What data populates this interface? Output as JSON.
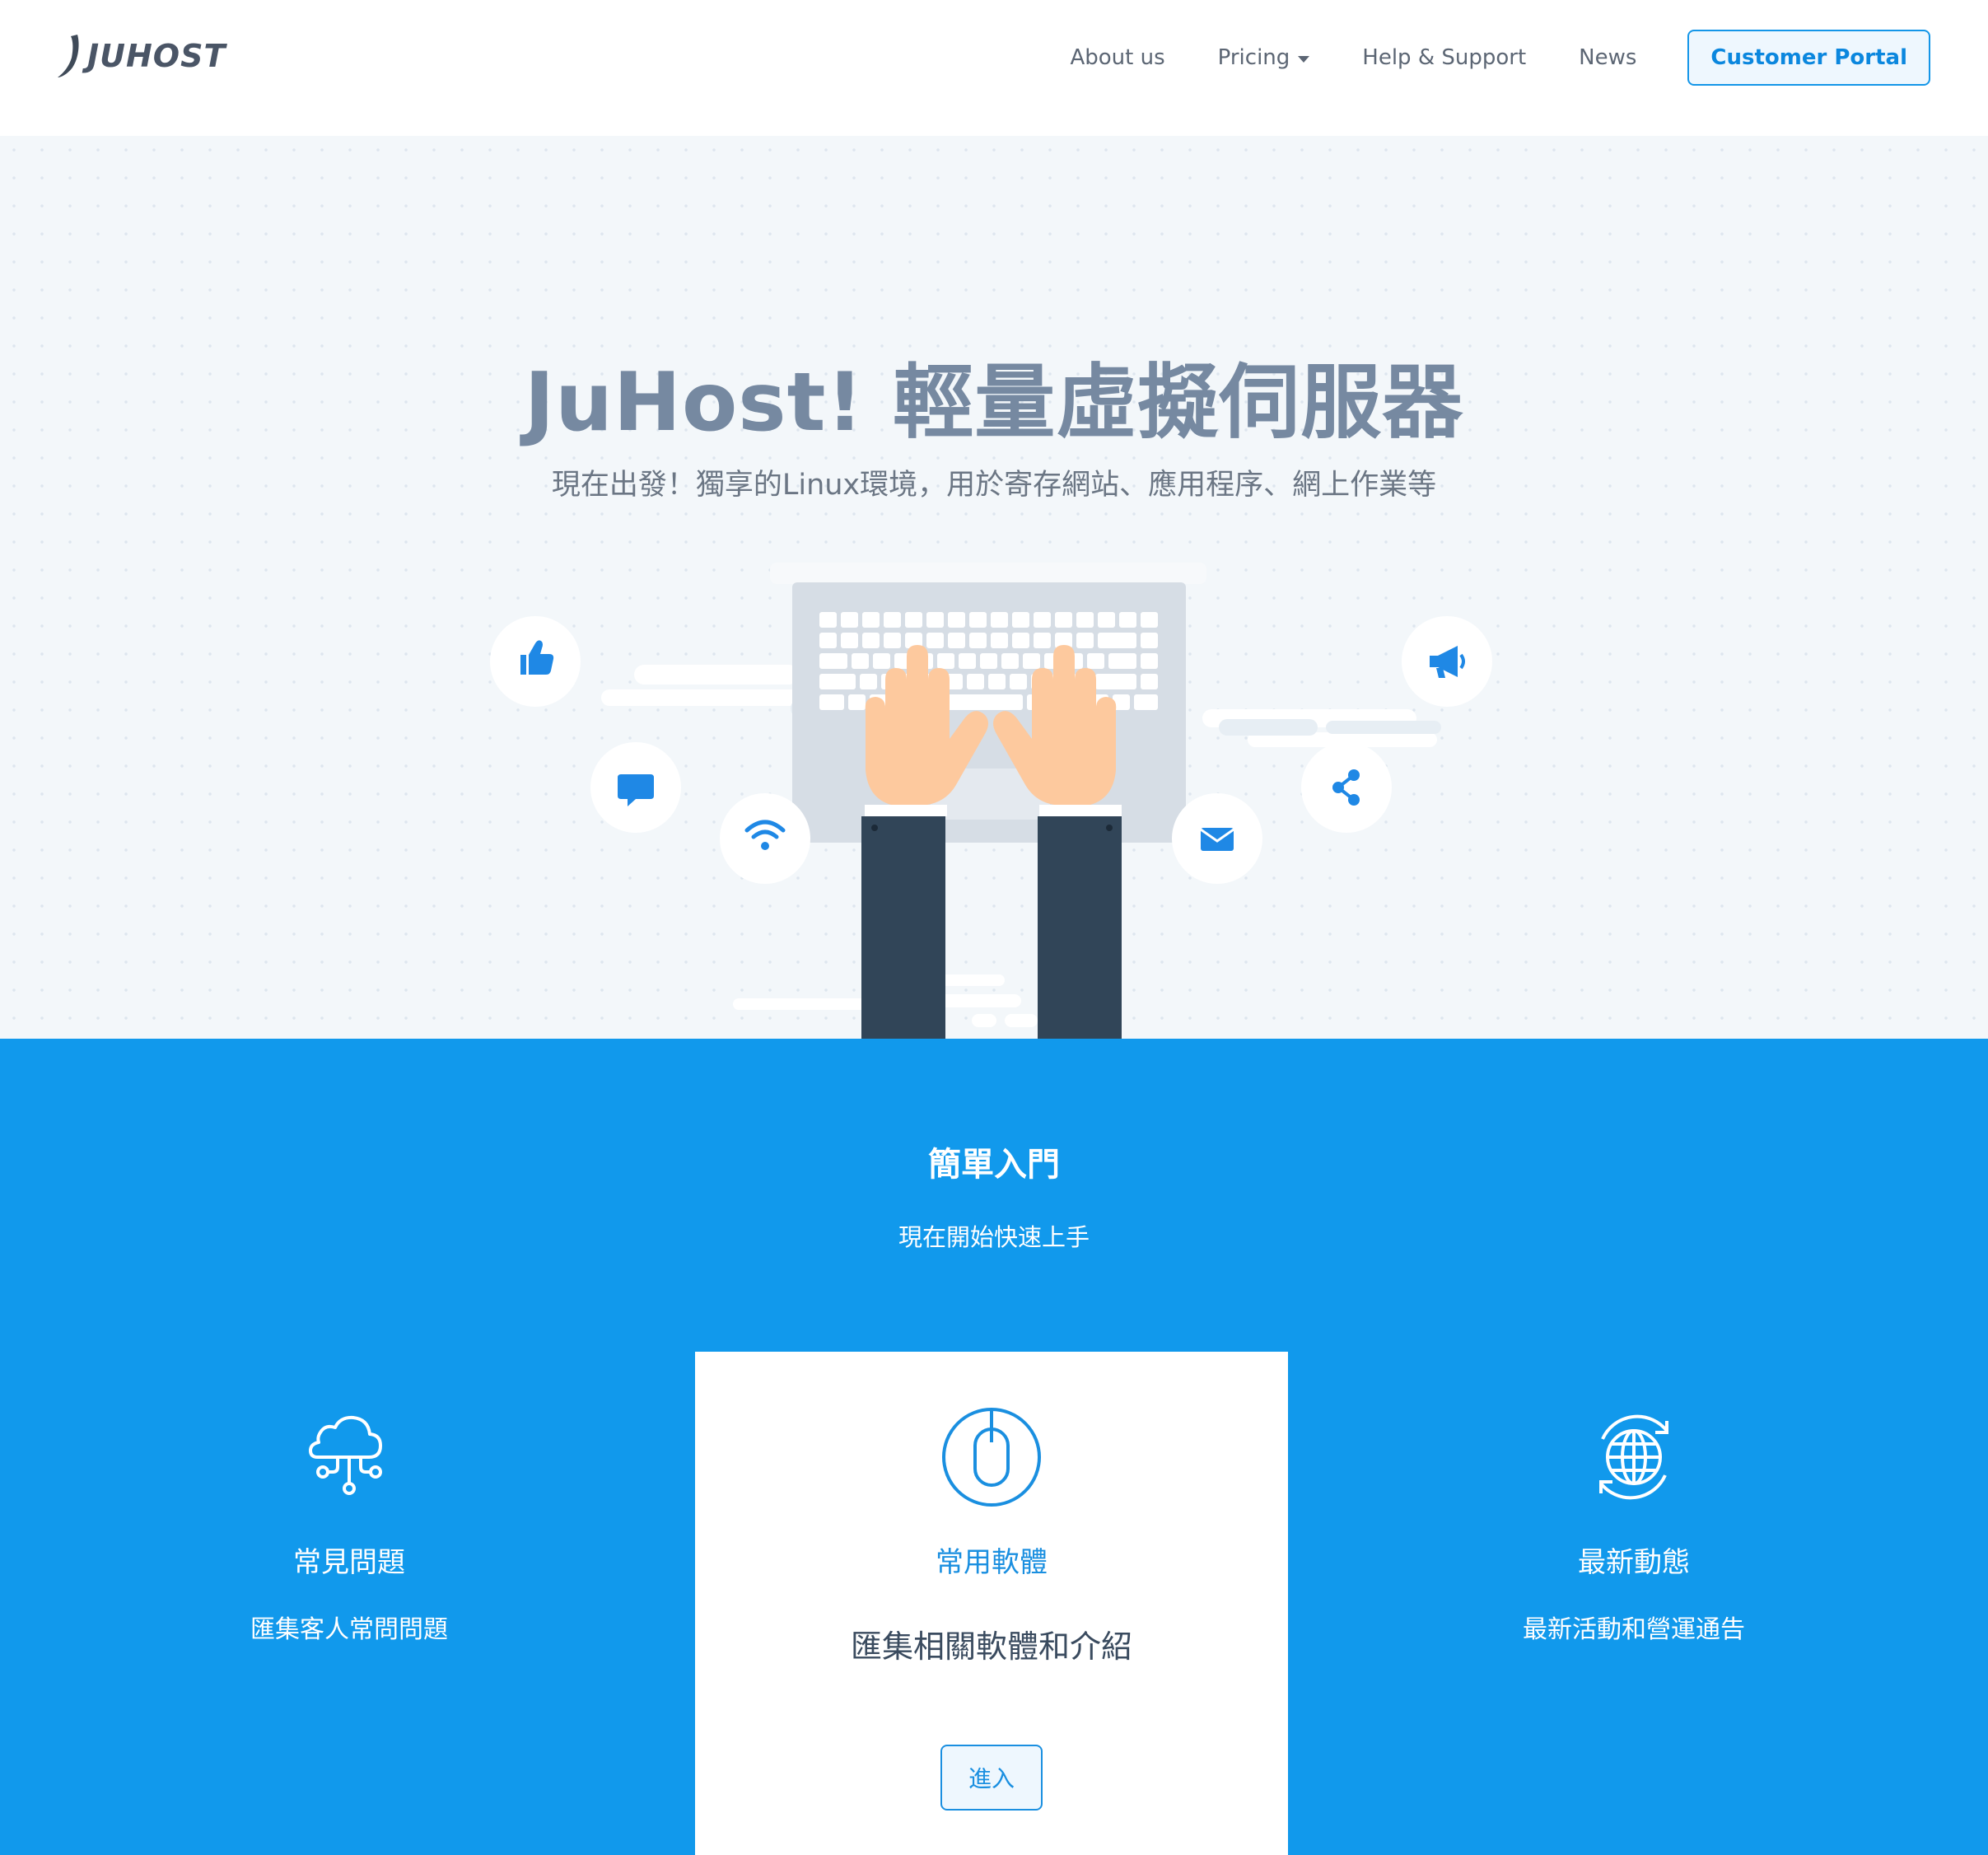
{
  "brand": {
    "name": "JUHOST"
  },
  "nav": {
    "links": [
      {
        "label": "About us"
      },
      {
        "label": "Pricing"
      },
      {
        "label": "Help & Support"
      },
      {
        "label": "News"
      }
    ],
    "portal_label": "Customer Portal"
  },
  "hero": {
    "title": "JuHost! 輕量虛擬伺服器",
    "subtitle": "現在出發！獨享的Linux環境，用於寄存網站、應用程序、網上作業等",
    "floating_icons": [
      "thumbs-up-icon",
      "megaphone-icon",
      "chat-icon",
      "share-icon",
      "wifi-icon",
      "envelope-icon"
    ]
  },
  "getting_started": {
    "title": "簡單入門",
    "subtitle": "現在開始快速上手",
    "cards": [
      {
        "icon": "cloud-network-icon",
        "title": "常見問題",
        "desc": "匯集客人常問問題"
      },
      {
        "icon": "mouse-icon",
        "title": "常用軟體",
        "desc": "匯集相關軟體和介紹",
        "button": "進入"
      },
      {
        "icon": "globe-refresh-icon",
        "title": "最新動態",
        "desc": "最新活動和營運通告"
      }
    ]
  },
  "colors": {
    "accent": "#1199ec",
    "hero_bg": "#f3f7fa",
    "title": "#7689a1"
  }
}
